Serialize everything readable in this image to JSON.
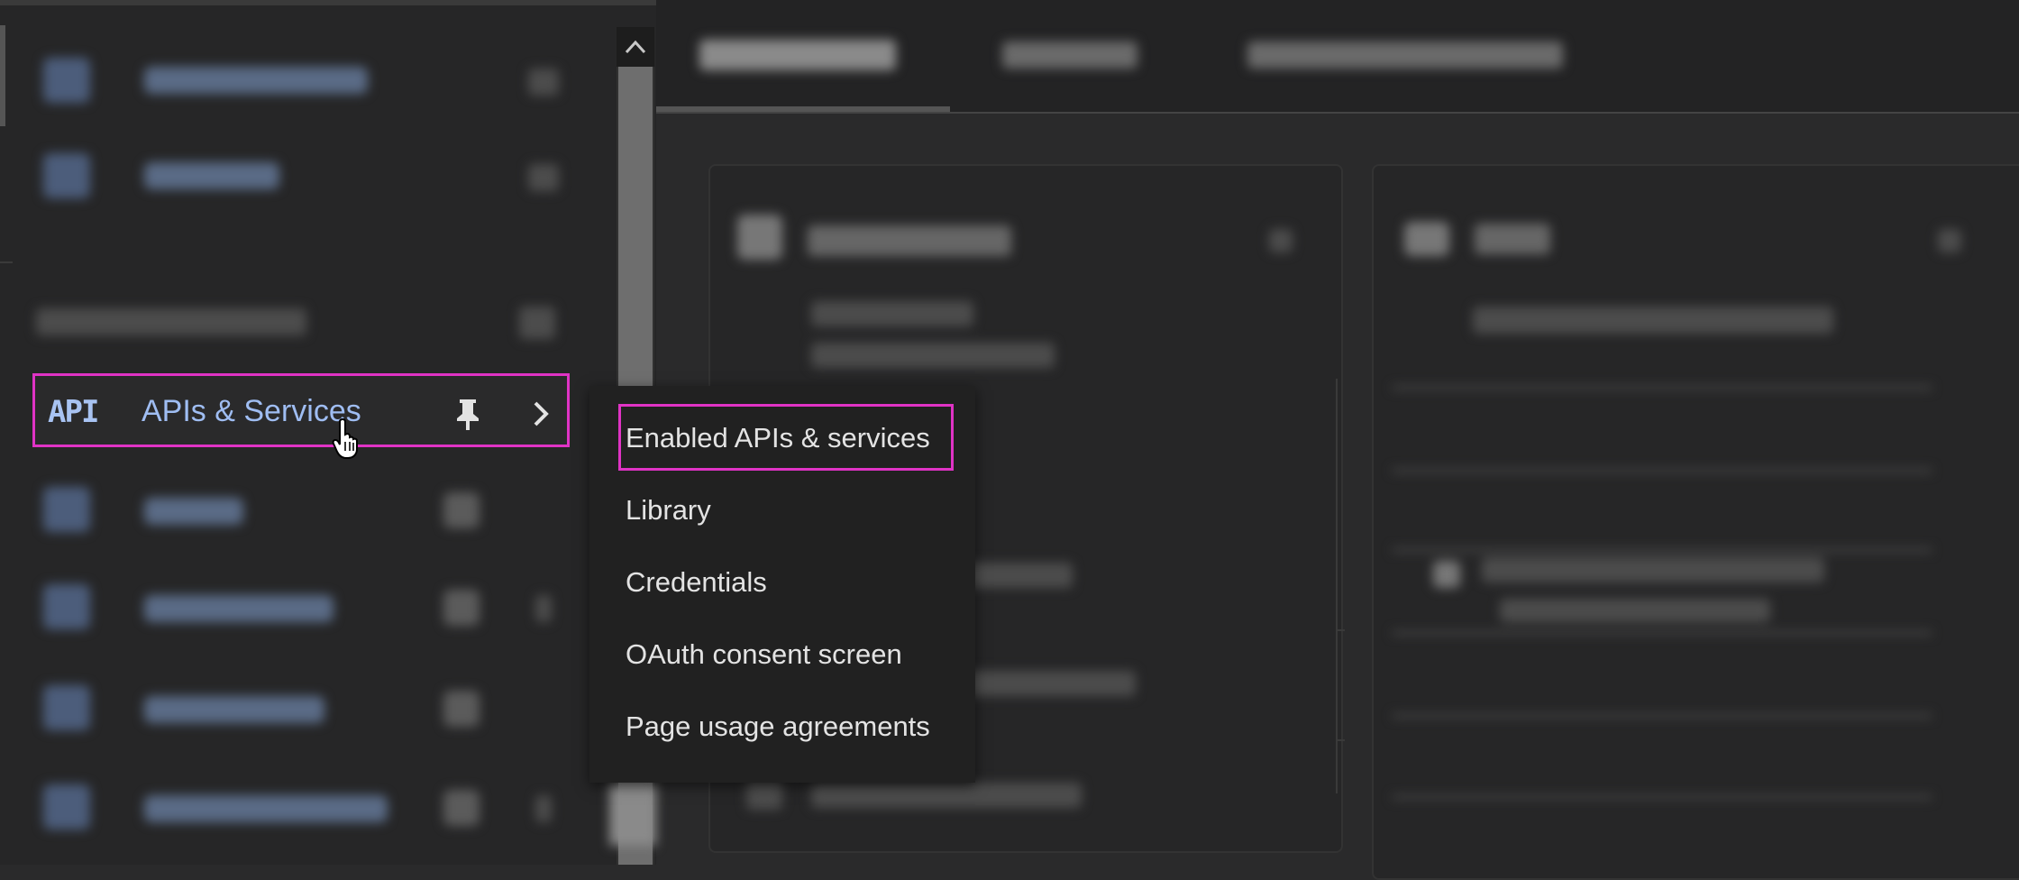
{
  "sidebar": {
    "highlighted_item": {
      "icon": "API",
      "label": "APIs & Services"
    },
    "pin_icon": "pin-icon",
    "chevron_icon": "chevron-right-icon"
  },
  "submenu": {
    "items": [
      {
        "label": "Enabled APIs & services"
      },
      {
        "label": "Library"
      },
      {
        "label": "Credentials"
      },
      {
        "label": "OAuth consent screen"
      },
      {
        "label": "Page usage agreements"
      }
    ]
  },
  "colors": {
    "highlight_border": "#e033c5",
    "link_blue": "#9fbdf2"
  }
}
